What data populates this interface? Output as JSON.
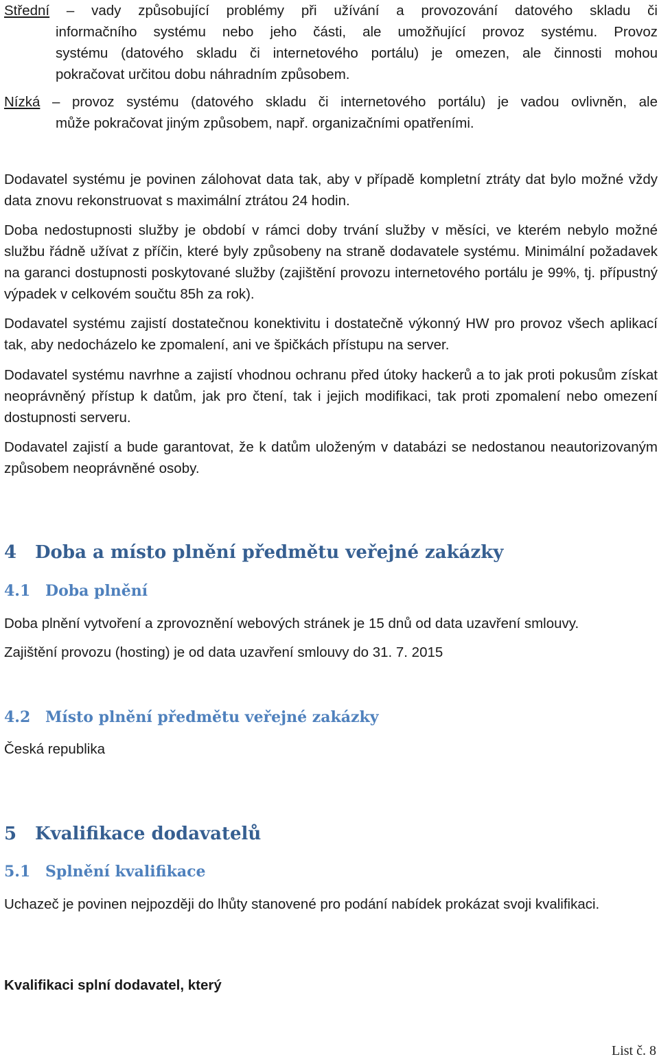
{
  "definitions": [
    {
      "term": "Střední",
      "lines": [
        " – vady způsobující problémy při užívání a provozování datového skladu či",
        "informačního systému nebo jeho části, ale umožňující provoz systému. Provoz",
        "systému (datového skladu či internetového portálu) je omezen, ale činnosti mohou",
        "pokračovat určitou dobu náhradním způsobem."
      ]
    },
    {
      "term": "Nízká",
      "lines": [
        " – provoz systému (datového skladu či internetového portálu) je vadou ovlivněn, ale",
        "může pokračovat jiným způsobem, např. organizačními opatřeními."
      ]
    }
  ],
  "paragraphs": {
    "backup": "Dodavatel systému je povinen zálohovat data tak, aby v případě kompletní ztráty dat bylo možné vždy data znovu rekonstruovat s maximální ztrátou 24 hodin.",
    "unavailability": "Doba nedostupnosti služby je období v rámci doby trvání služby v měsíci, ve kterém nebylo možné službu řádně užívat z příčin, které byly způsobeny na straně dodavatele systému. Minimální požadavek na garanci dostupnosti poskytované služby (zajištění provozu internetového portálu je 99%, tj. přípustný výpadek v celkovém součtu 85h za rok).",
    "connectivity": "Dodavatel systému zajistí dostatečnou konektivitu i dostatečně výkonný HW pro provoz všech aplikací tak, aby nedocházelo ke zpomalení, ani ve špičkách přístupu na server.",
    "security": "Dodavatel systému navrhne a zajistí vhodnou ochranu před útoky hackerů a to jak proti pokusům získat neoprávněný přístup k datům, jak pro čtení, tak i jejich modifikaci, tak proti zpomalení nebo omezení dostupnosti serveru.",
    "data_protection": "Dodavatel zajistí a bude garantovat, že k datům uloženým v databázi se nedostanou neautorizovaným způsobem neoprávněné osoby."
  },
  "section4": {
    "number": "4",
    "title": "Doba a místo plnění předmětu veřejné zakázky",
    "sub1": {
      "number": "4.1",
      "title": "Doba plnění",
      "p1": "Doba plnění vytvoření a zprovoznění webových stránek je 15 dnů od data uzavření smlouvy.",
      "p2": "Zajištění provozu (hosting) je od data uzavření smlouvy do 31. 7. 2015"
    },
    "sub2": {
      "number": "4.2",
      "title": "Místo plnění předmětu veřejné zakázky",
      "p1": "Česká republika"
    }
  },
  "section5": {
    "number": "5",
    "title": "Kvalifikace dodavatelů",
    "sub1": {
      "number": "5.1",
      "title": "Splnění kvalifikace",
      "p1": "Uchazeč je povinen nejpozději do lhůty stanovené pro podání nabídek prokázat svoji kvalifikaci.",
      "bold": "Kvalifikaci splní dodavatel, který"
    }
  },
  "footer": {
    "page_label": "List č. 8"
  }
}
